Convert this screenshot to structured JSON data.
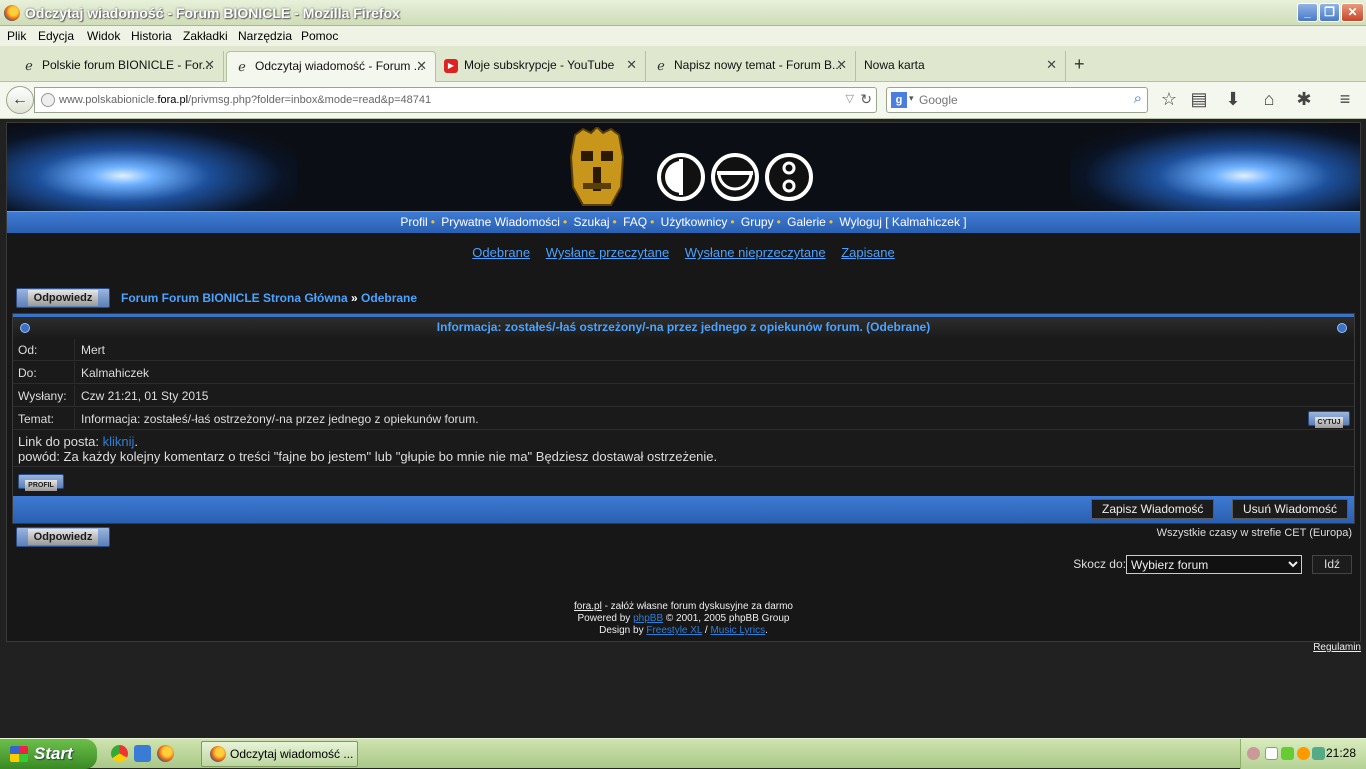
{
  "window": {
    "title": "Odczytaj wiadomość - Forum BIONICLE - Mozilla Firefox"
  },
  "menu": [
    "Plik",
    "Edycja",
    "Widok",
    "Historia",
    "Zakładki",
    "Narzędzia",
    "Pomoc"
  ],
  "tabs": [
    {
      "label": "Polskie forum BIONICLE - For...",
      "icon": "ie-icon",
      "active": false
    },
    {
      "label": "Odczytaj wiadomość - Forum ...",
      "icon": "ie-icon",
      "active": true
    },
    {
      "label": "Moje subskrypcje - YouTube",
      "icon": "youtube-icon",
      "active": false
    },
    {
      "label": "Napisz nowy temat - Forum B...",
      "icon": "ie-icon",
      "active": false
    },
    {
      "label": "Nowa karta",
      "icon": "",
      "active": false
    }
  ],
  "nav": {
    "url_pre": "www.polskabionicle.",
    "url_host": "fora.pl",
    "url_post": "/privmsg.php?folder=inbox&mode=read&p=48741",
    "search_placeholder": "Google"
  },
  "forum": {
    "topnav": [
      "Profil",
      "Prywatne Wiadomości",
      "Szukaj",
      "FAQ",
      "Użytkownicy",
      "Grupy",
      "Galerie",
      "Wyloguj [ Kalmahiczek ]"
    ],
    "pmnav": [
      "Odebrane",
      "Wysłane przeczytane",
      "Wysłane nieprzeczytane",
      "Zapisane"
    ],
    "reply_label": "Odpowiedz",
    "crumb_home": "Forum Forum BIONICLE Strona Główna",
    "crumb_sep": "»",
    "crumb_current": "Odebrane",
    "msg_header": "Informacja: zostałeś/-łaś ostrzeżony/-na przez jednego z opiekunów forum.   (Odebrane)",
    "rows": [
      {
        "label": "Od:",
        "value": "Mert"
      },
      {
        "label": "Do:",
        "value": "Kalmahiczek"
      },
      {
        "label": "Wysłany:",
        "value": "Czw 21:21, 01 Sty 2015"
      },
      {
        "label": "Temat:",
        "value": "Informacja: zostałeś/-łaś ostrzeżony/-na przez jednego z opiekunów forum."
      }
    ],
    "quote_label": "CYTUJ",
    "body_line1_prefix": "Link do posta: ",
    "body_link": "kliknij",
    "body_line1_suffix": ".",
    "body_line2": "powód: Za każdy kolejny komentarz o treści \"fajne bo jestem\" lub \"głupie bo mnie nie ma\" Będziesz dostawał ostrzeżenie.",
    "profile_label": "PROFIL",
    "save_label": "Zapisz Wiadomość",
    "delete_label": "Usuń Wiadomość",
    "timezone": "Wszystkie czasy w strefie CET (Europa)",
    "jump_label": "Skocz do:",
    "jump_value": "Wybierz forum",
    "go_label": "Idź",
    "footer": {
      "l1_link": "fora.pl",
      "l1_text": " - załóż własne forum dyskusyjne za darmo",
      "l2_pre": "Powered by ",
      "l2_link": "phpBB",
      "l2_post": " © 2001, 2005 phpBB Group",
      "l3_pre": "Design by ",
      "l3_link1": "Freestyle XL",
      "l3_sep": " / ",
      "l3_link2": "Music Lyrics",
      "l3_post": "."
    },
    "regulamin": "Regulamin"
  },
  "taskbar": {
    "start": "Start",
    "item": "Odczytaj wiadomość ...",
    "clock": "21:28"
  },
  "colors": {
    "accent": "#3a72c6",
    "link": "#4aa3ff",
    "bg": "#171717"
  }
}
